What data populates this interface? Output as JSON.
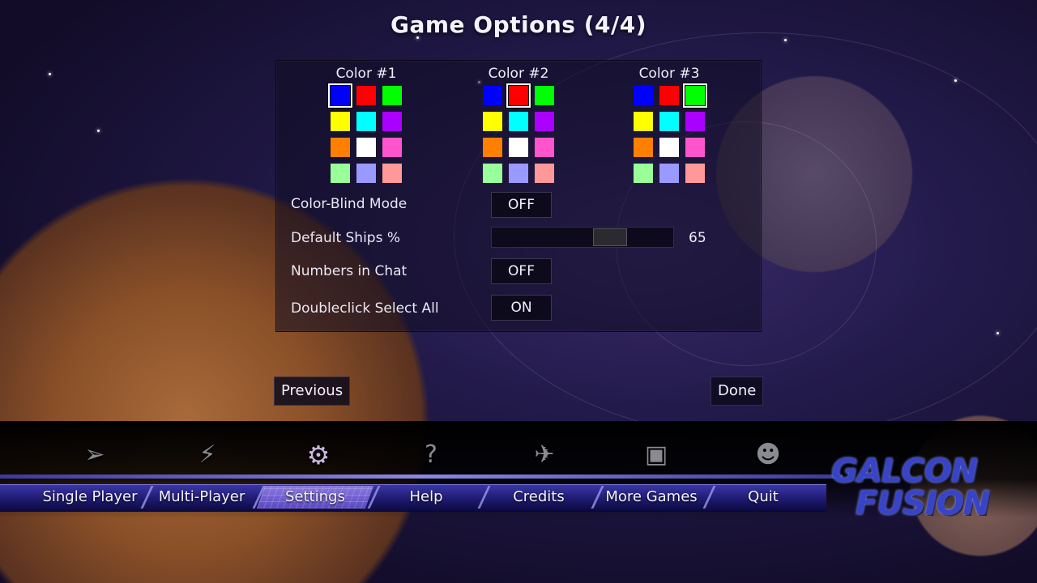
{
  "title": "Game Options (4/4)",
  "color_groups": [
    {
      "label": "Color #1",
      "selected_index": 0
    },
    {
      "label": "Color #2",
      "selected_index": 1
    },
    {
      "label": "Color #3",
      "selected_index": 2
    }
  ],
  "palette": [
    "#0000ff",
    "#ff0000",
    "#00ff00",
    "#ffff00",
    "#00ffff",
    "#aa00ff",
    "#ff7f00",
    "#ffffff",
    "#ff55cc",
    "#99ff99",
    "#9999ff",
    "#ff9999"
  ],
  "options": {
    "color_blind_label": "Color-Blind Mode",
    "color_blind_value": "OFF",
    "default_ships_label": "Default Ships %",
    "default_ships_value": "65",
    "default_ships_level": 0.65,
    "numbers_chat_label": "Numbers in Chat",
    "numbers_chat_value": "OFF",
    "doubleclick_label": "Doubleclick Select All",
    "doubleclick_value": "ON"
  },
  "buttons": {
    "previous": "Previous",
    "done": "Done"
  },
  "menu": {
    "tabs": [
      "Single Player",
      "Multi-Player",
      "Settings",
      "Help",
      "Credits",
      "More Games",
      "Quit"
    ],
    "active_tab": "Settings",
    "icons": [
      "arrow-icon",
      "lightning-icon",
      "gears-icon",
      "question-icon",
      "ship-icon",
      "treasure-chest-icon",
      "face-icon"
    ]
  },
  "logo": {
    "line1": "GALCON",
    "line2": "FUSION"
  }
}
